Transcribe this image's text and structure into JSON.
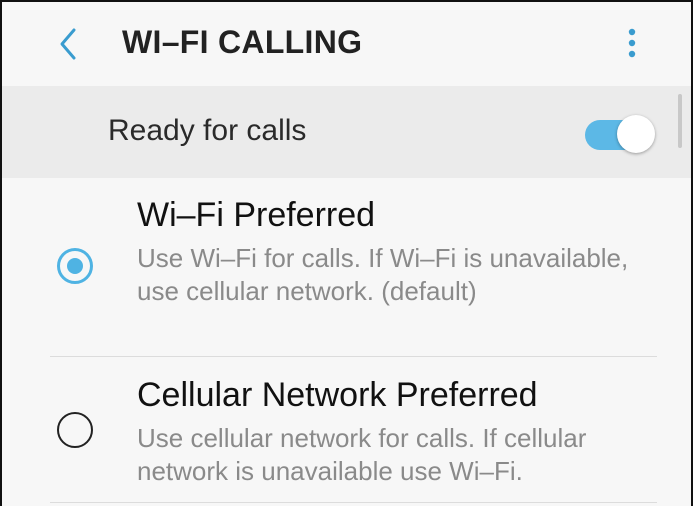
{
  "header": {
    "back_icon": "chevron-left-icon",
    "title": "WI–FI CALLING",
    "menu_icon": "more-vertical-icon"
  },
  "ready": {
    "label": "Ready for calls",
    "toggle_state": "on",
    "accent_color": "#5cb8e6"
  },
  "options": [
    {
      "title": "Wi–Fi Preferred",
      "description": "Use Wi–Fi for calls. If Wi–Fi is unavailable, use cellular network. (default)",
      "selected": true
    },
    {
      "title": "Cellular Network Preferred",
      "description": "Use cellular network for calls. If cellular network is unavailable use Wi–Fi.",
      "selected": false
    }
  ]
}
